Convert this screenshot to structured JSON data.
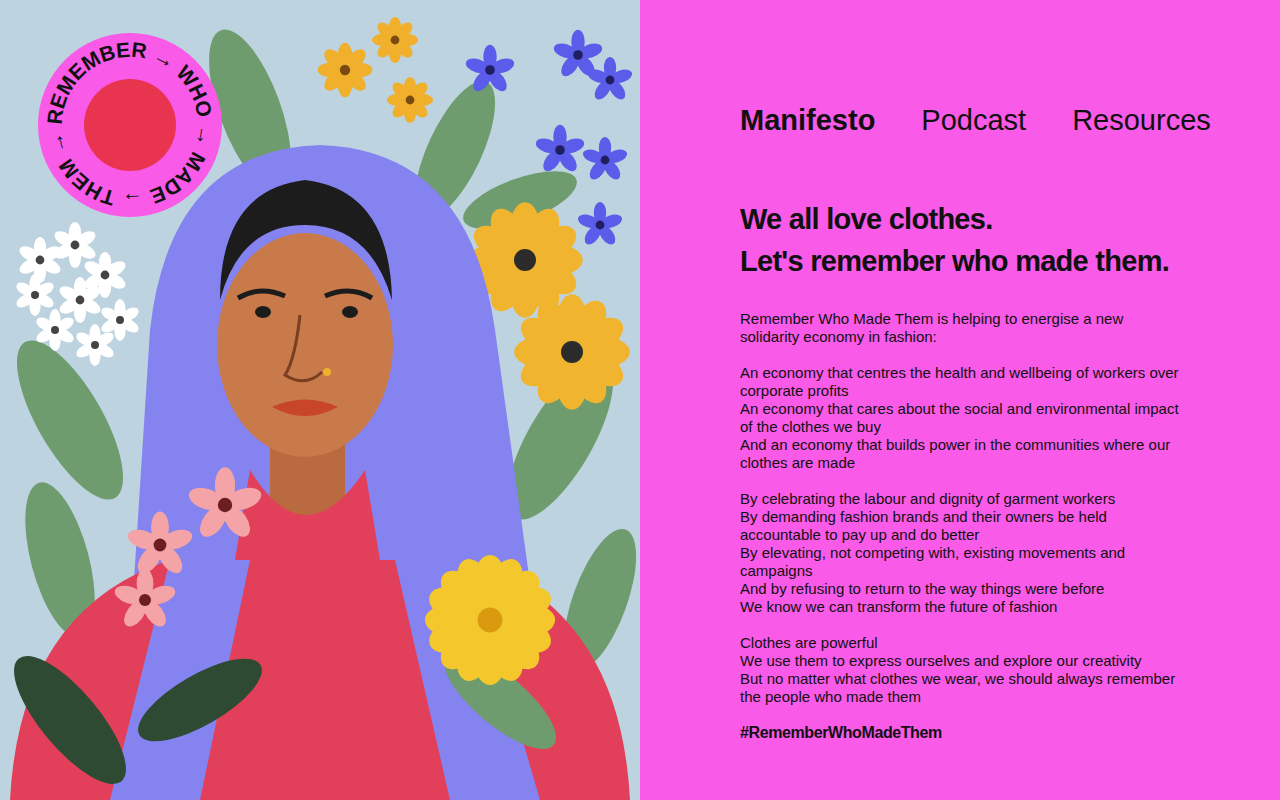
{
  "nav": [
    {
      "label": "Manifesto",
      "selected": true
    },
    {
      "label": "Podcast",
      "selected": false
    },
    {
      "label": "Resources",
      "selected": false
    }
  ],
  "illustration": {
    "badge": "REMEMBER → WHO → MADE → THEM →"
  },
  "heading": [
    "We all love clothes.",
    "Let's remember who made them."
  ],
  "paragraphs": [
    [
      "Remember Who Made Them is helping to energise a new solidarity economy in fashion:"
    ],
    [
      "An economy that centres the health and wellbeing of workers over corporate profits",
      "An economy that cares about the social and environmental impact of the clothes we buy",
      "And an economy that builds power in the communities where our clothes are made"
    ],
    [
      "By celebrating the labour and dignity of garment workers",
      "By demanding fashion brands and their owners be held accountable to pay up and do better",
      "By elevating, not competing with, existing movements and campaigns",
      "And by refusing to return to the way things were before",
      "We know we can transform the future of fashion"
    ],
    [
      "Clothes are powerful",
      "We use them to express ourselves and explore our creativity",
      "But no matter what clothes we wear, we should always remember the people who made them"
    ]
  ],
  "hashtag": "#RememberWhoMadeThem"
}
